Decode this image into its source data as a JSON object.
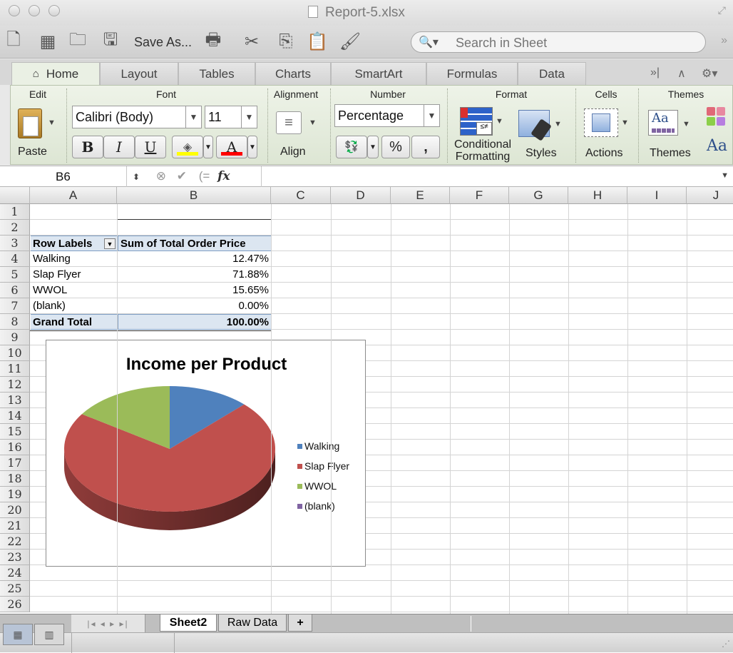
{
  "window": {
    "title": "Report-5.xlsx"
  },
  "toolbar": {
    "save_as_label": "Save As...",
    "search_placeholder": "Search in Sheet"
  },
  "ribbon_tabs": [
    "Home",
    "Layout",
    "Tables",
    "Charts",
    "SmartArt",
    "Formulas",
    "Data"
  ],
  "ribbon": {
    "groups": {
      "edit": "Edit",
      "font": "Font",
      "alignment": "Alignment",
      "number": "Number",
      "format": "Format",
      "cells": "Cells",
      "themes": "Themes"
    },
    "paste_label": "Paste",
    "font_name": "Calibri (Body)",
    "font_size": "11",
    "bold": "B",
    "italic": "I",
    "underline": "U",
    "font_color_letter": "A",
    "align_label": "Align",
    "number_format": "Percentage",
    "percent_symbol": "%",
    "comma_symbol": ",",
    "conditional_formatting": [
      "Conditional",
      "Formatting"
    ],
    "styles_label": "Styles",
    "actions_label": "Actions",
    "themes_label": "Themes",
    "themes_icon_text": "Aa",
    "fill_color": "#ffff00",
    "font_color": "#ff0000"
  },
  "formula_bar": {
    "name_box": "B6",
    "fx": "fx",
    "formula": ""
  },
  "columns": [
    "A",
    "B",
    "C",
    "D",
    "E",
    "F",
    "G",
    "H",
    "I",
    "J"
  ],
  "rows": [
    "1",
    "2",
    "3",
    "4",
    "5",
    "6",
    "7",
    "8",
    "9",
    "10",
    "11",
    "12",
    "13",
    "14",
    "15",
    "16",
    "17",
    "18",
    "19",
    "20",
    "21",
    "22",
    "23",
    "24",
    "25",
    "26"
  ],
  "pivot": {
    "header_label": "Row Labels",
    "header_value": "Sum of Total Order Price",
    "rows": [
      {
        "label": "Walking",
        "value": "12.47%"
      },
      {
        "label": "Slap Flyer",
        "value": "71.88%"
      },
      {
        "label": "WWOL",
        "value": "15.65%"
      },
      {
        "label": "(blank)",
        "value": "0.00%"
      }
    ],
    "total_label": "Grand Total",
    "total_value": "100.00%"
  },
  "chart_data": {
    "type": "pie",
    "title": "Income per Product",
    "categories": [
      "Walking",
      "Slap Flyer",
      "WWOL",
      "(blank)"
    ],
    "values": [
      12.47,
      71.88,
      15.65,
      0.0
    ],
    "colors": [
      "#4f81bd",
      "#c0504d",
      "#9bbb59",
      "#8064a2"
    ],
    "legend": "right",
    "style": "3d"
  },
  "sheets": {
    "tabs": [
      "Sheet2",
      "Raw Data"
    ],
    "active": "Sheet2",
    "add_label": "+"
  }
}
